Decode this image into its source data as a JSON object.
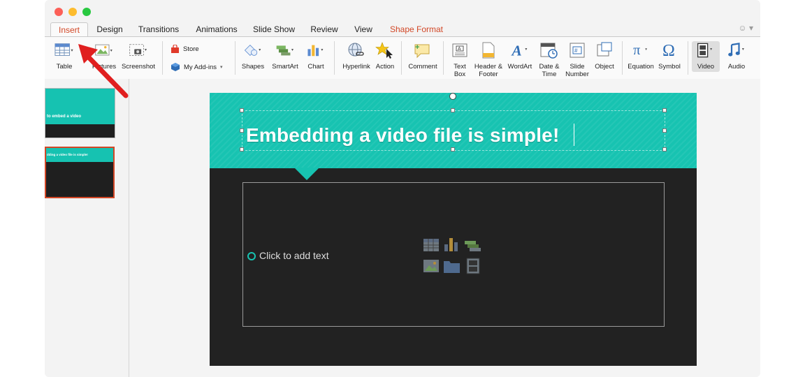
{
  "tabs": [
    {
      "label": "Insert",
      "active": true
    },
    {
      "label": "Design"
    },
    {
      "label": "Transitions"
    },
    {
      "label": "Animations"
    },
    {
      "label": "Slide Show"
    },
    {
      "label": "Review"
    },
    {
      "label": "View"
    },
    {
      "label": "Shape Format",
      "contextual": true
    }
  ],
  "ribbon": {
    "table": "Table",
    "pictures": "Pictures",
    "screenshot": "Screenshot",
    "store": "Store",
    "addins": "My Add-ins",
    "shapes": "Shapes",
    "smartart": "SmartArt",
    "chart": "Chart",
    "hyperlink": "Hyperlink",
    "action": "Action",
    "comment": "Comment",
    "textbox_1": "Text",
    "textbox_2": "Box",
    "header_1": "Header &",
    "header_2": "Footer",
    "wordart": "WordArt",
    "datetime_1": "Date &",
    "datetime_2": "Time",
    "slidenum_1": "Slide",
    "slidenum_2": "Number",
    "object": "Object",
    "equation": "Equation",
    "symbol": "Symbol",
    "video": "Video",
    "audio": "Audio"
  },
  "thumbnails": {
    "slide1_text": "to embed a video",
    "slide2_text": "dding a video file is simple!"
  },
  "slide": {
    "title": "Embedding a video file is simple!",
    "body_placeholder": "Click to add text"
  },
  "colors": {
    "accent": "#d24726",
    "teal": "#17c3b1",
    "slide_bg": "#222222",
    "annotation_arrow": "#e01f1f"
  }
}
